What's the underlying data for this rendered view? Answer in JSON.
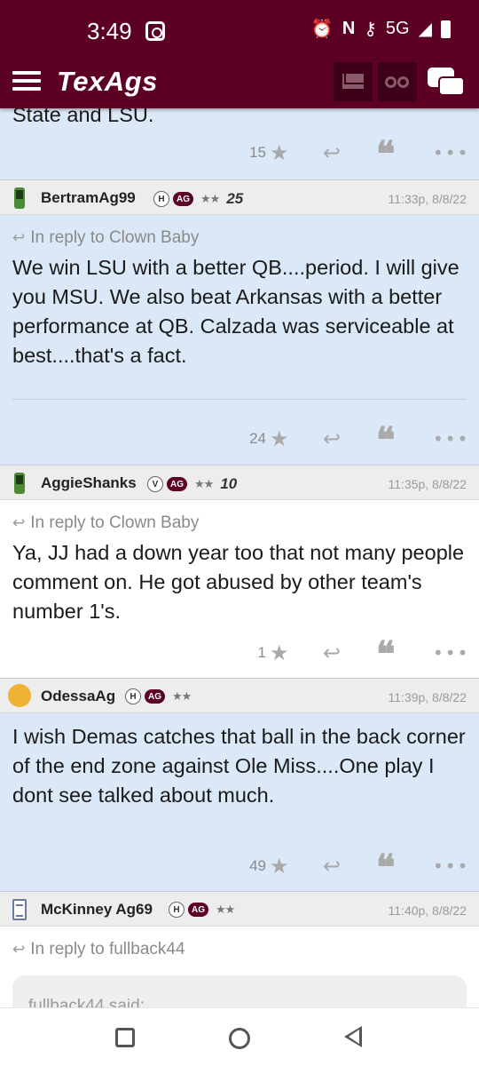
{
  "status_bar": {
    "time": "3:49",
    "network": "5G"
  },
  "app": {
    "logo": "TexAgs"
  },
  "top_post": {
    "partial_text": "State and LSU.",
    "like_count": "15"
  },
  "posts": [
    {
      "username": "BertramAg99",
      "badge_letter": "H",
      "badge_ag": "AG",
      "stars": "★★",
      "level": "25",
      "time": "11:33p, 8/8/22",
      "reply_to": "In reply to Clown Baby",
      "text": "We win LSU with a better QB....period. I will give you MSU. We also beat Arkansas with a better performance at QB. Calzada was serviceable at best....that's a fact.",
      "like_count": "24"
    },
    {
      "username": "AggieShanks",
      "badge_letter": "V",
      "badge_ag": "AG",
      "stars": "★★",
      "level": "10",
      "time": "11:35p, 8/8/22",
      "reply_to": "In reply to Clown Baby",
      "text": "Ya, JJ had a down year too that not many people comment on. He got abused by other team's number 1's.",
      "like_count": "1"
    },
    {
      "username": "OdessaAg",
      "badge_letter": "H",
      "badge_ag": "AG",
      "stars": "★★",
      "time": "11:39p, 8/8/22",
      "text": "I wish Demas catches that ball in the back corner of the end zone against Ole Miss....One play I dont see talked about much.",
      "like_count": "49"
    },
    {
      "username": "McKinney Ag69",
      "badge_letter": "H",
      "badge_ag": "AG",
      "stars": "★★",
      "time": "11:40p, 8/8/22",
      "reply_to": "In reply to fullback44",
      "quote_label": "fullback44 said:"
    }
  ],
  "icons": {
    "star": "★",
    "reply": "↩",
    "quote": "❝",
    "more": "•••",
    "reply_small": "↩"
  },
  "colors": {
    "brand": "#5c0025",
    "post_bg": "#dbe8f8",
    "header_bg": "#ededed"
  }
}
